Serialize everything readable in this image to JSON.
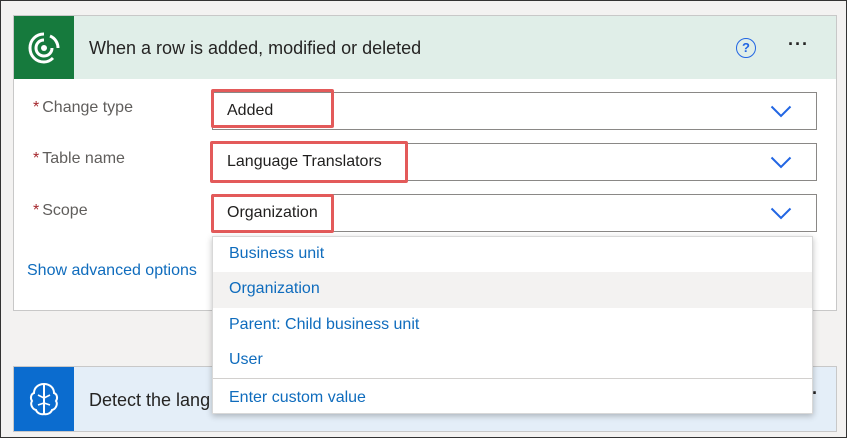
{
  "trigger_card": {
    "title": "When a row is added, modified or deleted",
    "help_icon": "?",
    "more_icon": "···",
    "fields": [
      {
        "label": "Change type",
        "required_mark": "*",
        "value": "Added"
      },
      {
        "label": "Table name",
        "required_mark": "*",
        "value": "Language Translators"
      },
      {
        "label": "Scope",
        "required_mark": "*",
        "value": "Organization"
      }
    ],
    "advanced_link": "Show advanced options"
  },
  "action_card": {
    "title": "Detect the lang",
    "more_icon": "·"
  },
  "scope_dropdown": {
    "options": [
      "Business unit",
      "Organization",
      "Parent: Child business unit",
      "User"
    ],
    "selected": "Organization",
    "custom": "Enter custom value"
  },
  "colors": {
    "dataverse_brand": "#167a3d",
    "ai_brand": "#0b6ccf",
    "link": "#0f6cbd",
    "highlight": "#e35a5a",
    "required": "#a4262c"
  },
  "icons": [
    "dataverse-logo-icon",
    "help-icon",
    "more-options-icon",
    "chevron-down-icon",
    "ai-builder-logo-icon"
  ]
}
